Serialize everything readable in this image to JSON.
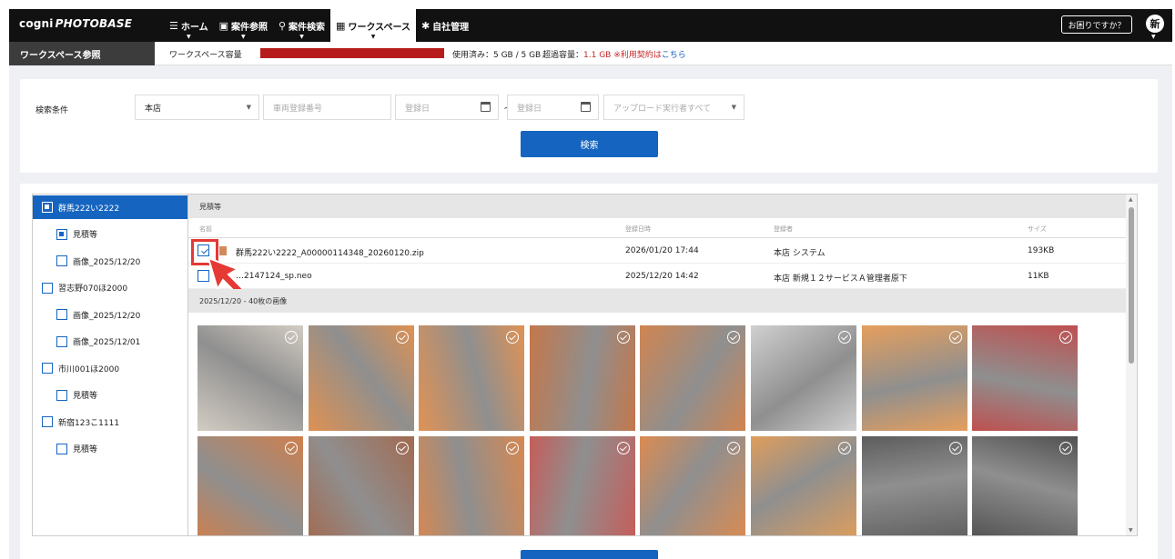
{
  "header": {
    "logo_main": "cogni",
    "logo_sub": "PHOTOBASE",
    "nav": [
      {
        "label": "ホーム",
        "icon": "list-icon"
      },
      {
        "label": "案件参照",
        "icon": "monitor-icon"
      },
      {
        "label": "案件検索",
        "icon": "search-icon"
      },
      {
        "label": "ワークスペース",
        "icon": "workspace-icon"
      },
      {
        "label": "自社管理",
        "icon": "gear-icon"
      }
    ],
    "help": "お困りですか？",
    "avatar": "新"
  },
  "capacity": {
    "title": "ワークスペース参照",
    "label": "ワークスペース容量",
    "used": "使用済み：5 GB / 5 GB",
    "over_label": "超過容量：",
    "over_value": "1.1 GB ※利用契約は",
    "over_link": "こちら",
    "bar_color": "#b71c1c"
  },
  "search": {
    "label": "検索条件",
    "store": "本店",
    "plate_placeholder": "車両登録番号",
    "date_from_placeholder": "登録日",
    "tilde": "~",
    "date_to_placeholder": "登録日",
    "uploader": "アップロード実行者すべて",
    "button": "検索"
  },
  "tree": [
    {
      "label": "群馬222い2222",
      "level": 0,
      "selected": true,
      "checked": true
    },
    {
      "label": "見積等",
      "level": 1,
      "checked": true
    },
    {
      "label": "画像_2025/12/20",
      "level": 1
    },
    {
      "label": "習志野070ほ2000",
      "level": 0
    },
    {
      "label": "画像_2025/12/20",
      "level": 1
    },
    {
      "label": "画像_2025/12/01",
      "level": 1
    },
    {
      "label": "市川001ほ2000",
      "level": 0
    },
    {
      "label": "見積等",
      "level": 1
    },
    {
      "label": "新宿123こ1111",
      "level": 0
    },
    {
      "label": "見積等",
      "level": 1
    }
  ],
  "files": {
    "section": "見積等",
    "columns": [
      "名前",
      "登録日時",
      "登録者",
      "サイズ"
    ],
    "rows": [
      {
        "name": "群馬222い2222_A00000114348_20260120.zip",
        "date": "2026/01/20 17:44",
        "user": "本店 システム",
        "size": "193KB"
      },
      {
        "name": "…2147124_sp.neo",
        "date": "2025/12/20 14:42",
        "user": "本店 新規１２サービスＡ管理者原下",
        "size": "11KB"
      }
    ]
  },
  "images": {
    "section": "2025/12/20 - 40枚の画像",
    "colors": [
      "#c9c1b6",
      "#d8792c",
      "#d97a30",
      "#b75a24",
      "#c76a2a",
      "#c6c6c6",
      "#e08a3a",
      "#b12a2a",
      "#c46428",
      "#8e4a2c",
      "#cc6f2e",
      "#b93a36",
      "#d5722b",
      "#d98938",
      "#3a3a3a",
      "#2b2b2b"
    ]
  }
}
